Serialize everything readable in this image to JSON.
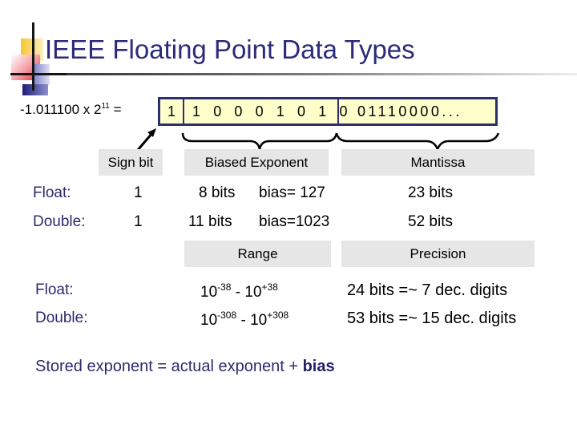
{
  "title": "IEEE Floating Point Data Types",
  "equation": {
    "mantissa_text": "-1.011100 x 2",
    "exponent": "11",
    "equals": "="
  },
  "register": {
    "sign_bits": "1",
    "exponent_bits": "1 0 0 0 1 0 1 0",
    "mantissa_bits": "01110000..."
  },
  "field_labels": {
    "sign": "Sign bit",
    "exponent": "Biased Exponent",
    "mantissa": "Mantissa",
    "range": "Range",
    "precision": "Precision"
  },
  "formats": [
    {
      "name": "Float:",
      "sign": "1",
      "exp_bits": "8 bits",
      "bias": "bias= 127",
      "mantissa_bits": "23 bits",
      "range_low_base": "10",
      "range_low_exp": "-38",
      "range_sep": " - ",
      "range_high_base": "10",
      "range_high_exp": "+38",
      "precision": "24 bits =~ 7 dec. digits"
    },
    {
      "name": "Double:",
      "sign": "1",
      "exp_bits": "11 bits",
      "bias": "bias=1023",
      "mantissa_bits": "52 bits",
      "range_low_base": "10",
      "range_low_exp": "-308",
      "range_sep": " - ",
      "range_high_base": "10",
      "range_high_exp": "+308",
      "precision": "53 bits =~ 15 dec. digits"
    }
  ],
  "footer": {
    "text": "Stored exponent = actual exponent + ",
    "bold": "bias"
  },
  "colors": {
    "title": "#2b2b7a",
    "register_fill": "#ffffcc",
    "register_border": "#2e2e70",
    "label_box": "#e6e6e6"
  }
}
